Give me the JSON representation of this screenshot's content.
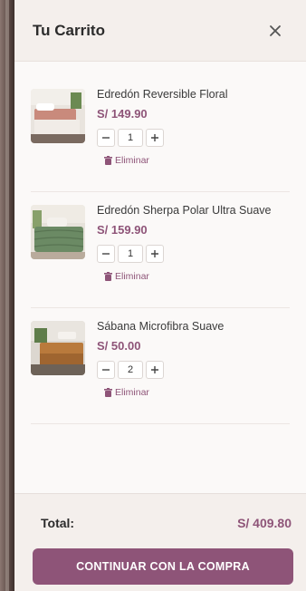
{
  "cart": {
    "title": "Tu Carrito",
    "items": [
      {
        "name": "Edredón Reversible Floral",
        "price": "S/ 149.90",
        "quantity": "1",
        "remove_label": "Eliminar"
      },
      {
        "name": "Edredón Sherpa Polar Ultra Suave",
        "price": "S/ 159.90",
        "quantity": "1",
        "remove_label": "Eliminar"
      },
      {
        "name": "Sábana Microfibra Suave",
        "price": "S/ 50.00",
        "quantity": "2",
        "remove_label": "Eliminar"
      }
    ],
    "total_label": "Total:",
    "total_value": "S/ 409.80",
    "checkout_label": "CONTINUAR CON LA COMPRA"
  },
  "icons": {
    "close": "close-icon",
    "remove": "trash-icon",
    "minus": "minus-icon",
    "plus": "plus-icon"
  },
  "colors": {
    "accent": "#8e5478",
    "header_bg": "#f4efec",
    "panel_bg": "#fbf9f8"
  }
}
